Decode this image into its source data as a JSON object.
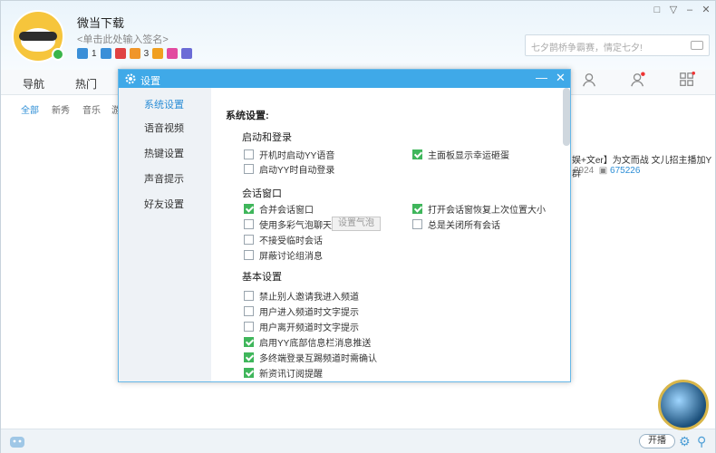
{
  "app": {
    "username": "微当下载",
    "signature": "<单击此处输入签名>",
    "badges": [
      {
        "icon": "medal-icon",
        "count": "1",
        "color": "#3a8fd8"
      },
      {
        "icon": "diamond-icon",
        "count": "",
        "color": "#3a8fd8"
      },
      {
        "icon": "vip-icon",
        "count": "",
        "color": "#e04242"
      },
      {
        "icon": "level-icon",
        "count": "3",
        "color": "#f0962a"
      },
      {
        "icon": "crown-icon",
        "count": "",
        "color": "#f0a020"
      },
      {
        "icon": "heart-icon",
        "count": "",
        "color": "#e24aa0"
      },
      {
        "icon": "eye-icon",
        "count": "",
        "color": "#6b6bd6"
      }
    ],
    "search_placeholder": "七夕鹊桥争霸赛，情定七夕!",
    "window_controls": [
      "□",
      "▽",
      "–",
      "✕"
    ]
  },
  "tabs": {
    "nav": "导航",
    "hot": "热门"
  },
  "subtabs": {
    "all": "全部",
    "newshow": "新秀",
    "music": "音乐",
    "more": "游"
  },
  "right_panel": {
    "line1": "娱+文er】为文而战   文儿招主播加Y群",
    "count1": "2924",
    "count2": "675226"
  },
  "bottom": {
    "live_label": "开播"
  },
  "dialog": {
    "title": "设置",
    "nav": [
      "系统设置",
      "语音视频",
      "热键设置",
      "声音提示",
      "好友设置"
    ],
    "section_title": "系统设置:",
    "groups": [
      {
        "title": "启动和登录"
      },
      {
        "title": "会话窗口"
      },
      {
        "title": "基本设置"
      }
    ],
    "options": {
      "autostart": {
        "label": "开机时启动YY语音",
        "checked": false
      },
      "fortune": {
        "label": "主面板显示幸运砸蛋",
        "checked": true
      },
      "autologin": {
        "label": "启动YY时自动登录",
        "checked": false
      },
      "merge": {
        "label": "合并会话窗口",
        "checked": true
      },
      "restore": {
        "label": "打开会话窗恢复上次位置大小",
        "checked": true
      },
      "bubble": {
        "label": "使用多彩气泡聊天",
        "checked": false
      },
      "closeall": {
        "label": "总是关闭所有会话",
        "checked": false
      },
      "notemp": {
        "label": "不接受临时会话",
        "checked": false
      },
      "blockgroup": {
        "label": "屏蔽讨论组消息",
        "checked": false
      },
      "noinvite": {
        "label": "禁止别人邀请我进入频道",
        "checked": false
      },
      "enterhint": {
        "label": "用户进入频道时文字提示",
        "checked": false
      },
      "leavehint": {
        "label": "用户离开频道时文字提示",
        "checked": false
      },
      "bottominfo": {
        "label": "启用YY底部信息栏消息推送",
        "checked": true
      },
      "multilogin": {
        "label": "多终端登录互踢频道时需确认",
        "checked": true
      },
      "subscribe": {
        "label": "新资讯订阅提醒",
        "checked": true
      }
    },
    "bubble_button": "设置气泡"
  }
}
